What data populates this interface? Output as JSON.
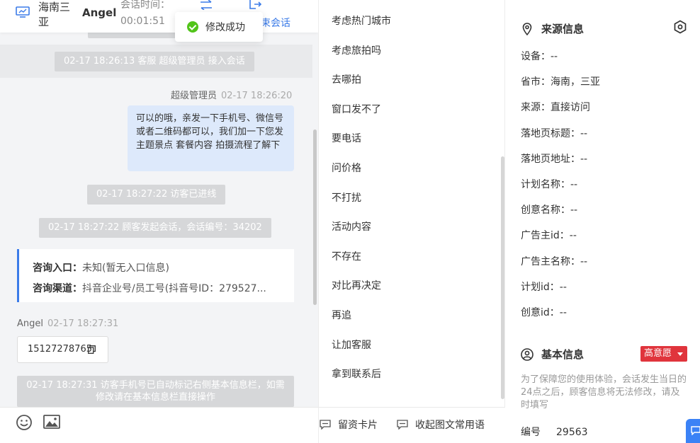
{
  "header": {
    "location": "海南三亚",
    "visitor_name": "Angel",
    "session_time_label": "会话时间：",
    "session_time_value": "00:01:51",
    "end_session_label": "束会话"
  },
  "toast": {
    "text": "修改成功"
  },
  "chat": {
    "system_1": "02-17 18:26:13 客服 超级管理员 接入会话",
    "agent_name": "超级管理员",
    "agent_time": "02-17 18:26:20",
    "agent_message": "可以的哦，亲发一下手机号、微信号或者二维码都可以，我们加一下您发主题景点 套餐内容 拍摄流程了解下",
    "system_2": "02-17 18:27:22 访客已进线",
    "system_3": "02-17 18:27:22 顾客发起会话，会话编号：34202",
    "card": {
      "entry_key": "咨询入口：",
      "entry_value": "未知(暂无入口信息)",
      "channel_key": "咨询渠道：",
      "channel_value": "抖音企业号/员工号(抖音号ID：279527..."
    },
    "visitor_name": "Angel",
    "visitor_time": "02-17 18:27:31",
    "visitor_phone": "15127278765",
    "system_4": "02-17 18:27:31 访客手机号已自动标记右侧基本信息栏，如需修改请在基本信息栏直接操作"
  },
  "replies": {
    "items": [
      "考虑热门城市",
      "考虑旅拍吗",
      "去哪拍",
      "窗口发不了",
      "要电话",
      "问价格",
      "不打扰",
      "活动内容",
      "不存在",
      "对比再决定",
      "再追",
      "让加客服",
      "拿到联系后"
    ],
    "footer_card_label": "留资卡片",
    "footer_collapse_label": "收起图文常用语"
  },
  "source_info": {
    "title": "来源信息",
    "fields": [
      "设备：--",
      "省市：海南，三亚",
      "来源：直接访问",
      "落地页标题：--",
      "落地页地址：--",
      "计划名称：--",
      "创意名称：--",
      "广告主id：--",
      "广告主名称：--",
      "计划id：--",
      "创意id：--"
    ]
  },
  "basic_info": {
    "title": "基本信息",
    "intent_label": "高意愿",
    "intent_color": "#e0343c",
    "note": "为了保障您的使用体验，会话发生当日的24点之后，顾客信息将无法修改，请及时填写",
    "id_label": "编号",
    "id_value": "29563"
  },
  "icons": [
    "monitor-icon",
    "transfer-icon",
    "end-session-icon",
    "check-circle-icon",
    "copy-icon",
    "emoji-icon",
    "image-icon",
    "chat-card-icon",
    "location-pin-icon",
    "settings-hex-icon",
    "user-circle-icon",
    "message-icon"
  ],
  "colors": {
    "accent": "#3b7be8",
    "success": "#52c41a",
    "bubble": "#dde9fb"
  }
}
